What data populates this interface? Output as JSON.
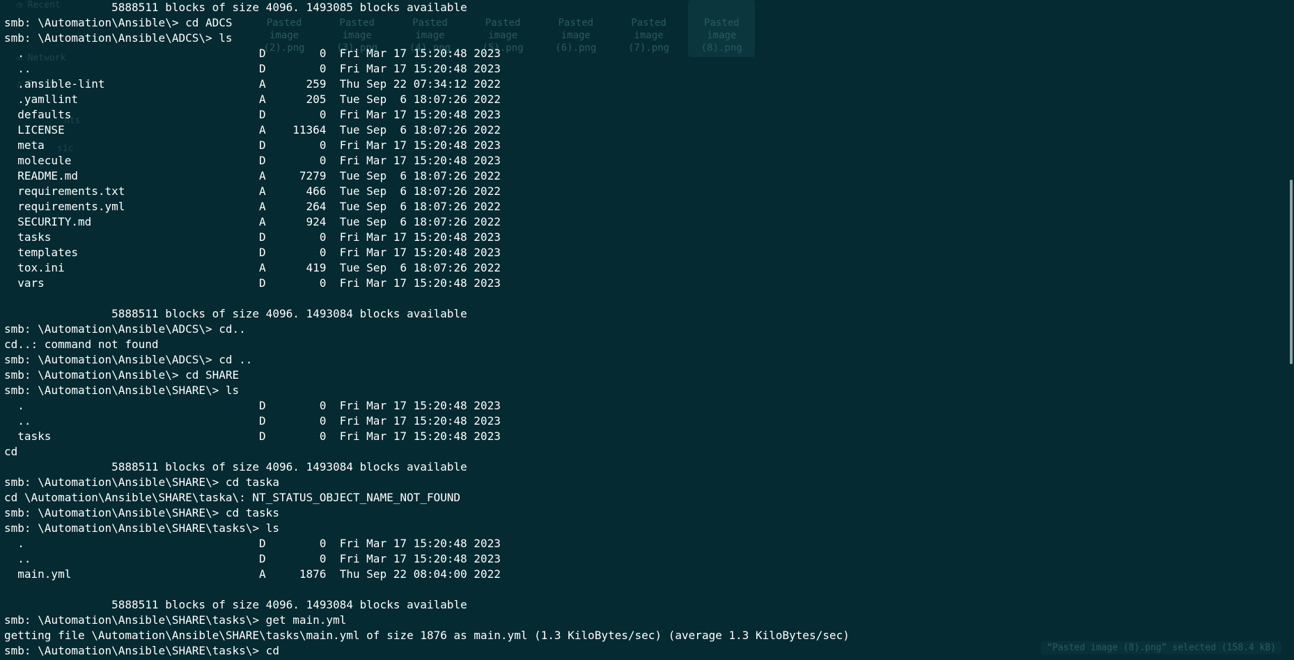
{
  "background_ghost": {
    "sidebar": [
      "Recent",
      "Network",
      "Trash",
      "nts",
      "sic"
    ],
    "thumbnails": [
      {
        "l1": "Pasted",
        "l2": "image",
        "l3": "(2).png"
      },
      {
        "l1": "Pasted",
        "l2": "image",
        "l3": "(3).png"
      },
      {
        "l1": "Pasted",
        "l2": "image",
        "l3": "(4).png"
      },
      {
        "l1": "Pasted",
        "l2": "image",
        "l3": "(5).png"
      },
      {
        "l1": "Pasted",
        "l2": "image",
        "l3": "(6).png"
      },
      {
        "l1": "Pasted",
        "l2": "image",
        "l3": "(7).png"
      },
      {
        "l1": "Pasted",
        "l2": "image",
        "l3": "(8).png"
      }
    ],
    "status": "“Pasted image (8).png” selected  (158.4 kB)"
  },
  "terminal": {
    "lines": [
      "                5888511 blocks of size 4096. 1493085 blocks available",
      "smb: \\Automation\\Ansible\\> cd ADCS",
      "smb: \\Automation\\Ansible\\ADCS\\> ls",
      "  .                                   D        0  Fri Mar 17 15:20:48 2023",
      "  ..                                  D        0  Fri Mar 17 15:20:48 2023",
      "  .ansible-lint                       A      259  Thu Sep 22 07:34:12 2022",
      "  .yamllint                           A      205  Tue Sep  6 18:07:26 2022",
      "  defaults                            D        0  Fri Mar 17 15:20:48 2023",
      "  LICENSE                             A    11364  Tue Sep  6 18:07:26 2022",
      "  meta                                D        0  Fri Mar 17 15:20:48 2023",
      "  molecule                            D        0  Fri Mar 17 15:20:48 2023",
      "  README.md                           A     7279  Tue Sep  6 18:07:26 2022",
      "  requirements.txt                    A      466  Tue Sep  6 18:07:26 2022",
      "  requirements.yml                    A      264  Tue Sep  6 18:07:26 2022",
      "  SECURITY.md                         A      924  Tue Sep  6 18:07:26 2022",
      "  tasks                               D        0  Fri Mar 17 15:20:48 2023",
      "  templates                           D        0  Fri Mar 17 15:20:48 2023",
      "  tox.ini                             A      419  Tue Sep  6 18:07:26 2022",
      "  vars                                D        0  Fri Mar 17 15:20:48 2023",
      "",
      "                5888511 blocks of size 4096. 1493084 blocks available",
      "smb: \\Automation\\Ansible\\ADCS\\> cd..",
      "cd..: command not found",
      "smb: \\Automation\\Ansible\\ADCS\\> cd ..",
      "smb: \\Automation\\Ansible\\> cd SHARE",
      "smb: \\Automation\\Ansible\\SHARE\\> ls",
      "  .                                   D        0  Fri Mar 17 15:20:48 2023",
      "  ..                                  D        0  Fri Mar 17 15:20:48 2023",
      "  tasks                               D        0  Fri Mar 17 15:20:48 2023",
      "cd",
      "                5888511 blocks of size 4096. 1493084 blocks available",
      "smb: \\Automation\\Ansible\\SHARE\\> cd taska",
      "cd \\Automation\\Ansible\\SHARE\\taska\\: NT_STATUS_OBJECT_NAME_NOT_FOUND",
      "smb: \\Automation\\Ansible\\SHARE\\> cd tasks",
      "smb: \\Automation\\Ansible\\SHARE\\tasks\\> ls",
      "  .                                   D        0  Fri Mar 17 15:20:48 2023",
      "  ..                                  D        0  Fri Mar 17 15:20:48 2023",
      "  main.yml                            A     1876  Thu Sep 22 08:04:00 2022",
      "",
      "                5888511 blocks of size 4096. 1493084 blocks available",
      "smb: \\Automation\\Ansible\\SHARE\\tasks\\> get main.yml",
      "getting file \\Automation\\Ansible\\SHARE\\tasks\\main.yml of size 1876 as main.yml (1.3 KiloBytes/sec) (average 1.3 KiloBytes/sec)",
      "smb: \\Automation\\Ansible\\SHARE\\tasks\\> cd"
    ]
  }
}
